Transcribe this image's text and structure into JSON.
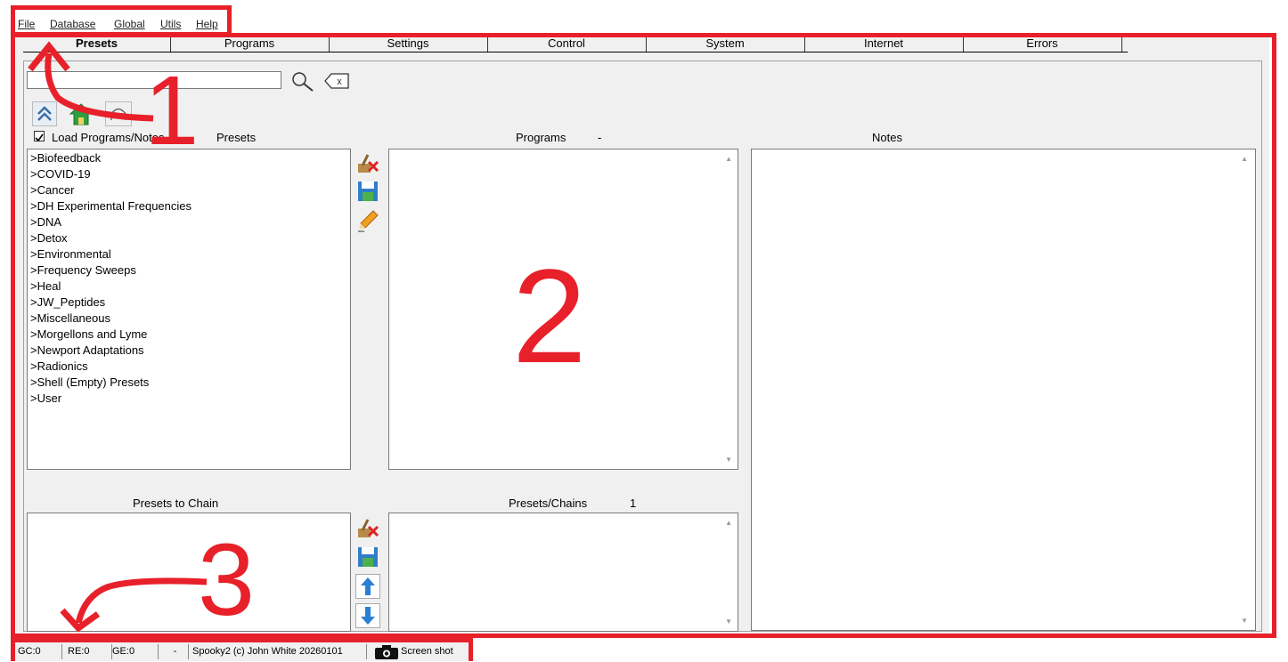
{
  "menu": [
    "File",
    "Database",
    "Global",
    "Utils",
    "Help"
  ],
  "tabs": [
    "Presets",
    "Programs",
    "Settings",
    "Control",
    "System",
    "Internet",
    "Errors"
  ],
  "search": {
    "value": ""
  },
  "load_programs_label": "Load Programs/Notes",
  "load_programs_checked": true,
  "panels": {
    "presets_title": "Presets",
    "programs_title": "Programs",
    "programs_count": "-",
    "notes_title": "Notes",
    "presets_to_chain_title": "Presets to Chain",
    "presets_chains_title": "Presets/Chains",
    "presets_chains_count": "1"
  },
  "presets": [
    ">Biofeedback",
    ">COVID-19",
    ">Cancer",
    ">DH Experimental Frequencies",
    ">DNA",
    ">Detox",
    ">Environmental",
    ">Frequency Sweeps",
    ">Heal",
    ">JW_Peptides",
    ">Miscellaneous",
    ">Morgellons and Lyme",
    ">Newport Adaptations",
    ">Radionics",
    ">Shell (Empty) Presets",
    ">User"
  ],
  "status": {
    "gc": "GC:0",
    "re": "RE:0",
    "ge": "GE:0",
    "dash": "-",
    "copyright": "Spooky2 (c) John White 20260101",
    "screenshot": "Screen shot"
  },
  "annotations": [
    "1",
    "2",
    "3"
  ],
  "colors": {
    "annotation": "#e8202a",
    "window_bg": "#f0f0f0"
  },
  "icons": [
    "search-icon",
    "clear-icon",
    "collapse-up-icon",
    "home-icon",
    "headphones-icon",
    "delete-broom-icon",
    "save-icon",
    "edit-pencil-icon",
    "move-up-icon",
    "move-down-icon",
    "camera-icon"
  ]
}
